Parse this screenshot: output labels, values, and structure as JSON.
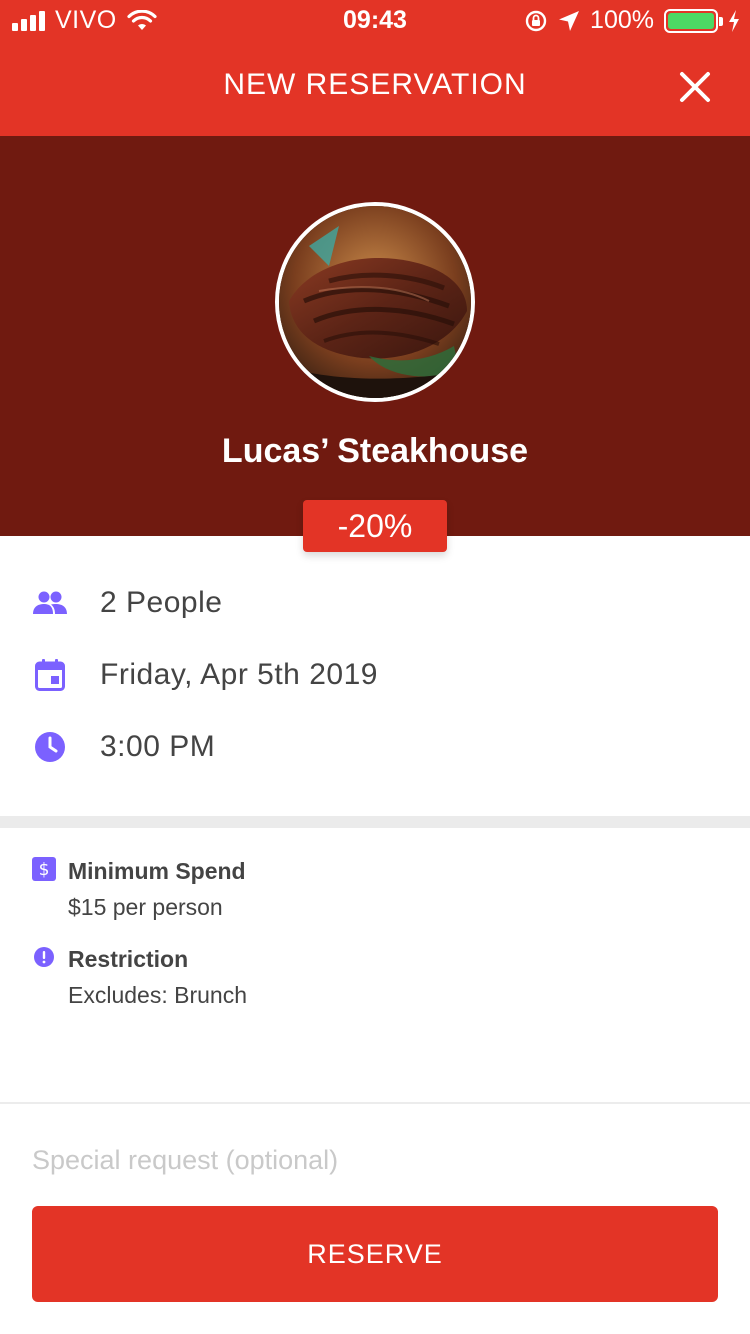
{
  "status_bar": {
    "carrier": "VIVO",
    "time": "09:43",
    "battery": "100%"
  },
  "nav": {
    "title": "NEW RESERVATION",
    "close_icon": "close-icon"
  },
  "restaurant": {
    "name": "Lucas’ Steakhouse",
    "discount": "-20%",
    "photo": "steak-photo"
  },
  "details": {
    "people": "2 People",
    "date": "Friday, Apr 5th 2019",
    "time": "3:00 PM"
  },
  "conditions": {
    "min_spend_title": "Minimum Spend",
    "min_spend_value": "$15 per person",
    "restriction_title": "Restriction",
    "restriction_value": "Excludes: Brunch"
  },
  "form": {
    "special_request_placeholder": "Special request (optional)",
    "reserve_label": "RESERVE"
  },
  "colors": {
    "brand_red": "#e33426",
    "hero_dark": "#701a10",
    "icon_purple": "#7b61ff"
  }
}
